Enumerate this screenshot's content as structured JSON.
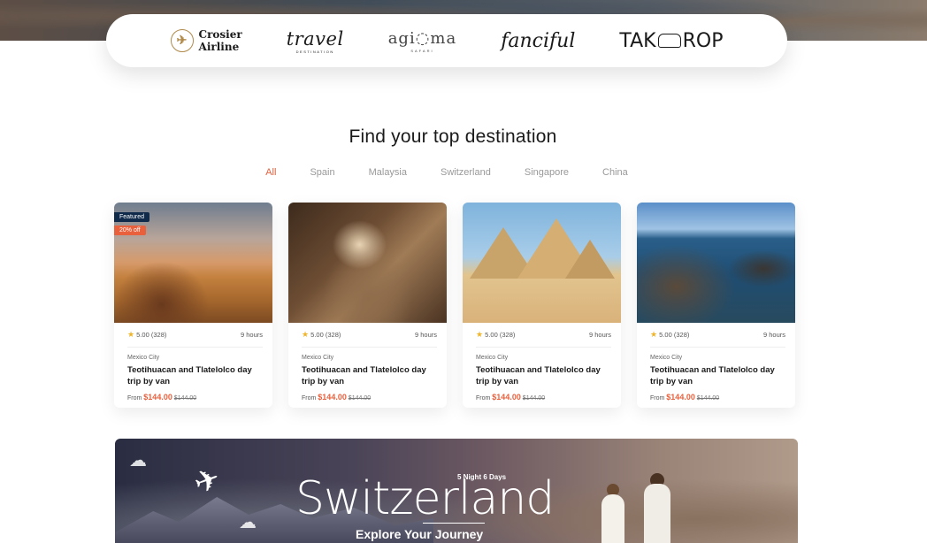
{
  "partners": {
    "crosier_line1": "Crosier",
    "crosier_line2": "Airline",
    "travel_main": "travel",
    "travel_sub": "DESTINATION",
    "agama_main": "agi◌ma",
    "agama_sub": "SAFARI",
    "fanciful": "fanciful",
    "takerop_left": "TAK",
    "takerop_right": "ROP"
  },
  "section": {
    "title": "Find your top destination",
    "tabs": [
      "All",
      "Spain",
      "Malaysia",
      "Switzerland",
      "Singapore",
      "China"
    ],
    "active_tab": "All"
  },
  "cards": [
    {
      "featured_label": "Featured",
      "discount_label": "20% off",
      "rating": "5.00 (328)",
      "duration": "9 hours",
      "location": "Mexico City",
      "title": "Teotihuacan and Tlatelolco day trip by van",
      "from_label": "From",
      "price": "$144.00",
      "old_price": "$144.00"
    },
    {
      "rating": "5.00 (328)",
      "duration": "9 hours",
      "location": "Mexico City",
      "title": "Teotihuacan and Tlatelolco day trip by van",
      "from_label": "From",
      "price": "$144.00",
      "old_price": "$144.00"
    },
    {
      "rating": "5.00 (328)",
      "duration": "9 hours",
      "location": "Mexico City",
      "title": "Teotihuacan and Tlatelolco day trip by van",
      "from_label": "From",
      "price": "$144.00",
      "old_price": "$144.00"
    },
    {
      "rating": "5.00 (328)",
      "duration": "9 hours",
      "location": "Mexico City",
      "title": "Teotihuacan and Tlatelolco day trip by van",
      "from_label": "From",
      "price": "$144.00",
      "old_price": "$144.00"
    }
  ],
  "banner": {
    "pre": "5 Night 6 Days",
    "title": "Switzerland",
    "subtitle": "Explore Your Journey"
  },
  "colors": {
    "accent": "#e8603c",
    "featured_badge": "#0f2a4a",
    "star": "#f0b429"
  }
}
